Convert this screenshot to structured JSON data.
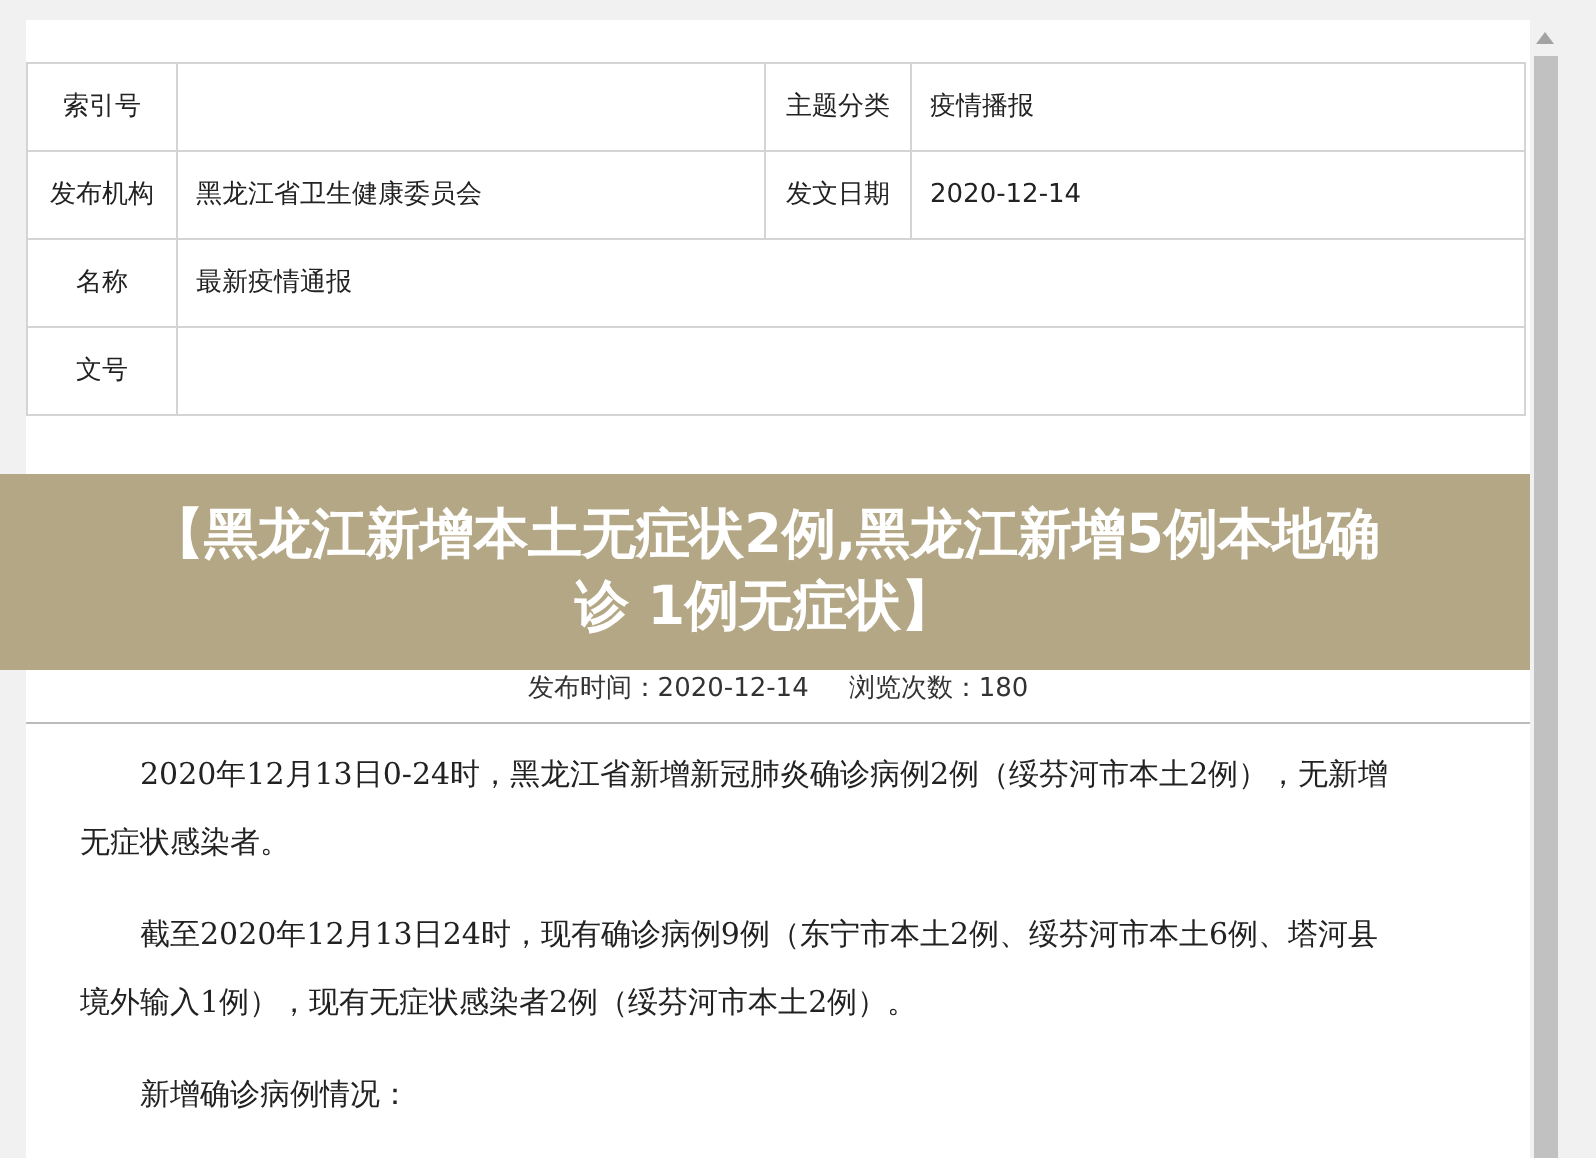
{
  "info_table": {
    "rows": [
      {
        "cells": [
          {
            "kind": "label",
            "text": "索引号"
          },
          {
            "kind": "value"
          },
          {
            "kind": "label",
            "text": "主题分类"
          },
          {
            "kind": "value",
            "text": "疫情播报"
          }
        ]
      },
      {
        "cells": [
          {
            "kind": "label",
            "text": "发布机构"
          },
          {
            "kind": "value",
            "text": "黑龙江省卫生健康委员会"
          },
          {
            "kind": "label",
            "text": "发文日期"
          },
          {
            "kind": "value",
            "text": "2020-12-14"
          }
        ]
      },
      {
        "cells": [
          {
            "kind": "label",
            "text": "名称"
          },
          {
            "kind": "value",
            "text": "最新疫情通报",
            "colspan": 3
          }
        ]
      },
      {
        "cells": [
          {
            "kind": "label",
            "text": "文号"
          },
          {
            "kind": "value",
            "colspan": 3
          }
        ]
      }
    ]
  },
  "headline_banner": {
    "text": "【黑龙江新增本土无症状2例,黑龙江新增5例本地确诊 1例无症状】"
  },
  "article": {
    "publish_time": "发布时间：2020-12-14",
    "views": "浏览次数：180",
    "paragraphs": [
      "2020年12月13日0-24时，黑龙江省新增新冠肺炎确诊病例2例（绥芬河市本土2例），无新增无症状感染者。",
      "截至2020年12月13日24时，现有确诊病例9例（东宁市本土2例、绥芬河市本土6例、塔河县境外输入1例），现有无症状感染者2例（绥芬河市本土2例）。",
      "新增确诊病例情况："
    ]
  }
}
